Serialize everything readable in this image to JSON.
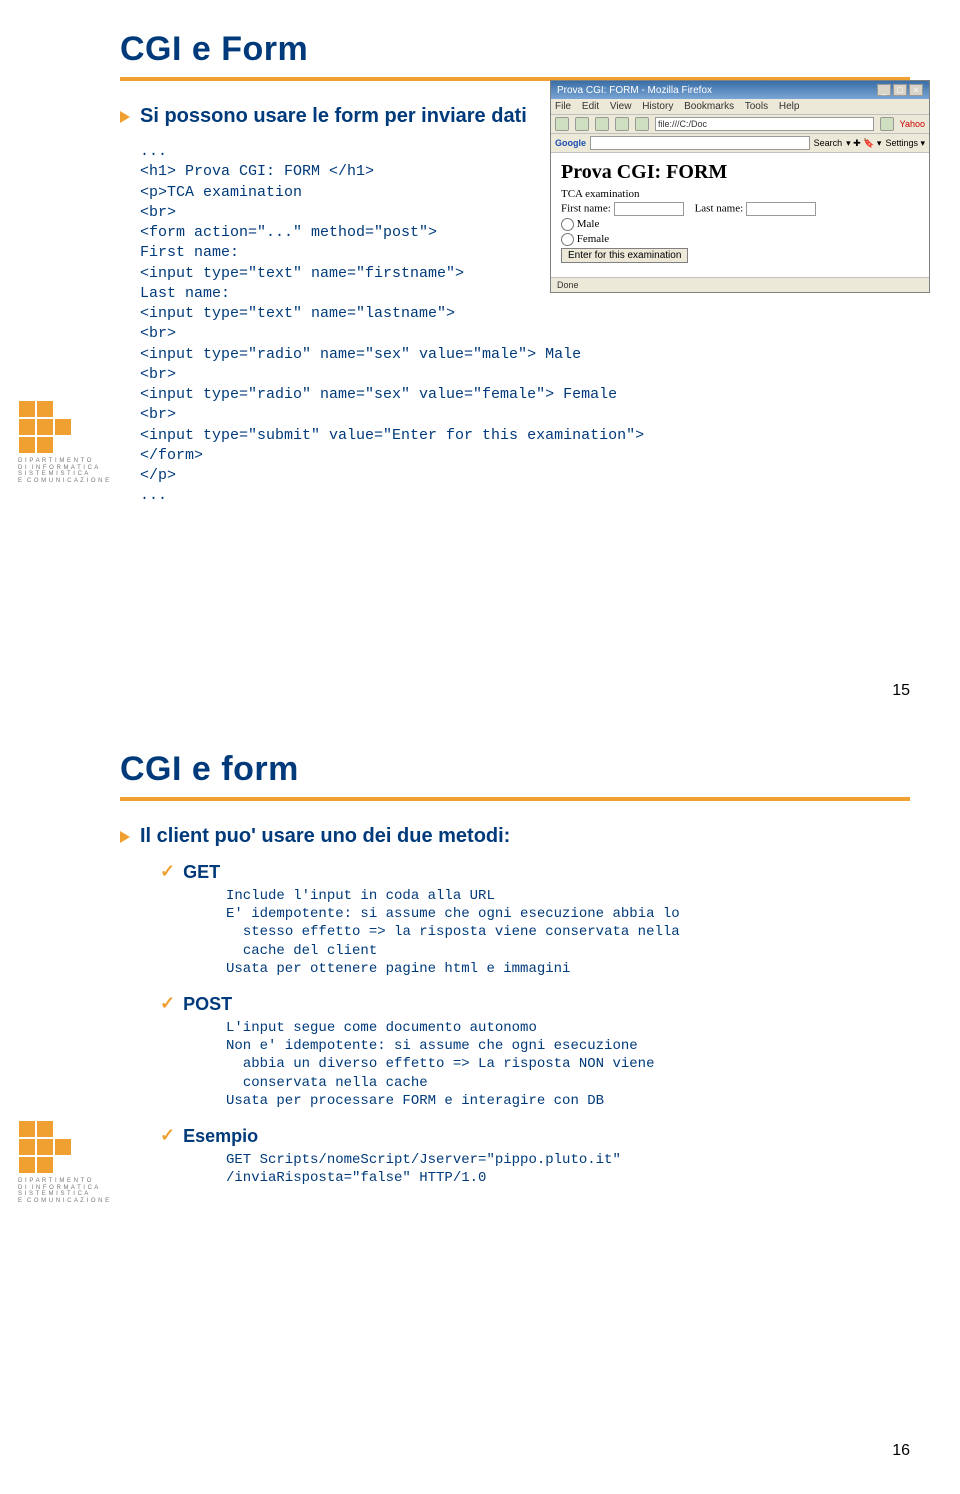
{
  "slide1": {
    "title": "CGI e Form",
    "bullet": "Si possono usare le form per inviare dati",
    "code": "...\n<h1> Prova CGI: FORM </h1>\n<p>TCA examination\n<br>\n<form action=\"...\" method=\"post\">\nFirst name:\n<input type=\"text\" name=\"firstname\">\nLast name:\n<input type=\"text\" name=\"lastname\">\n<br>\n<input type=\"radio\" name=\"sex\" value=\"male\"> Male\n<br>\n<input type=\"radio\" name=\"sex\" value=\"female\"> Female\n<br>\n<input type=\"submit\" value=\"Enter for this examination\">\n</form>\n</p>\n...",
    "pageNum": "15",
    "browser": {
      "title": "Prova CGI: FORM - Mozilla Firefox",
      "menus": [
        "File",
        "Edit",
        "View",
        "History",
        "Bookmarks",
        "Tools",
        "Help"
      ],
      "url": "file:///C:/Doc",
      "searchLabel": "Google",
      "searchBtn": "Search",
      "settings": "Settings ▾",
      "h1": "Prova CGI: FORM",
      "tca": "TCA examination",
      "first": "First name:",
      "last": "Last name:",
      "male": "Male",
      "female": "Female",
      "submit": "Enter for this examination",
      "status": "Done"
    }
  },
  "slide2": {
    "title": "CGI e form",
    "bullet": "Il client puo' usare uno dei due metodi:",
    "getLabel": "GET",
    "getBody": "Include l'input in coda alla URL\nE' idempotente: si assume che ogni esecuzione abbia lo\n  stesso effetto => la risposta viene conservata nella\n  cache del client\nUsata per ottenere pagine html e immagini",
    "postLabel": "POST",
    "postBody": "L'input segue come documento autonomo\nNon e' idempotente: si assume che ogni esecuzione\n  abbia un diverso effetto => La risposta NON viene\n  conservata nella cache\nUsata per processare FORM e interagire con DB",
    "exLabel": "Esempio",
    "exBody": "GET Scripts/nomeScript/Jserver=\"pippo.pluto.it\"\n/inviaRisposta=\"false\" HTTP/1.0",
    "pageNum": "16"
  },
  "logoText": "D I P A R T I M E N T O\nD I  I N F O R M A T I C A\nS I S T E M I S T I C A\nE  C O M U N I C A Z I O N E"
}
